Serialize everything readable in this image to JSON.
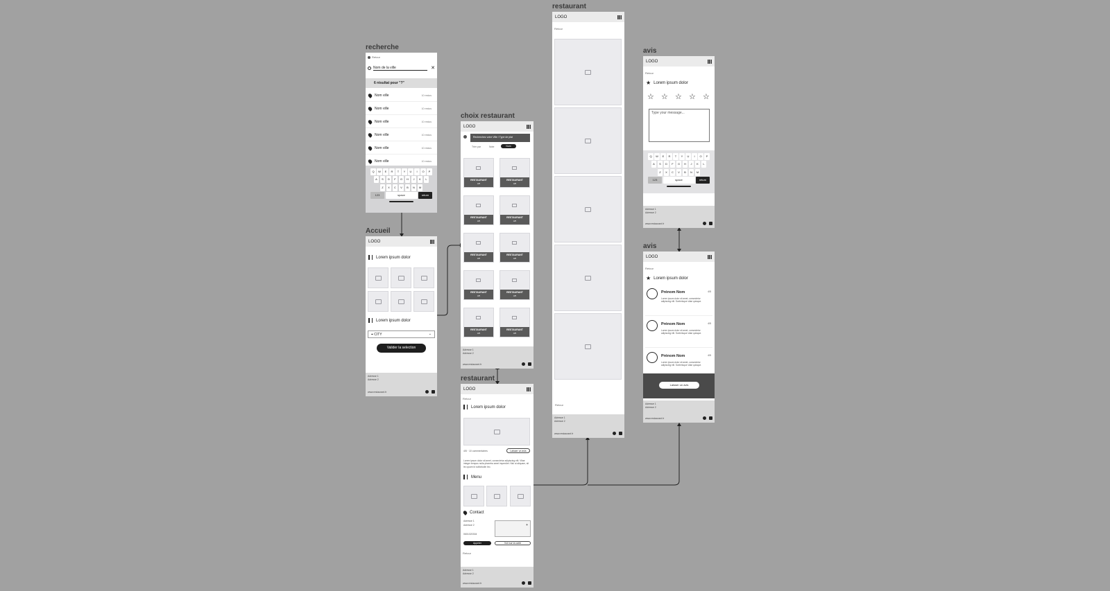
{
  "frames": {
    "recherche": {
      "title": "recherche",
      "back": "Retour",
      "search": "Nom de la ville",
      "results": "6 résultat pour \"?\"",
      "rows": [
        "Nom ville",
        "Nom ville",
        "Nom ville",
        "Nom ville",
        "Nom ville",
        "Nom ville"
      ],
      "row_meta": "10 restos",
      "kb": {
        "r1": [
          "Q",
          "W",
          "E",
          "R",
          "T",
          "Y",
          "U",
          "I",
          "O",
          "P"
        ],
        "r2": [
          "A",
          "S",
          "D",
          "F",
          "G",
          "H",
          "J",
          "K",
          "L"
        ],
        "r3": [
          "Z",
          "X",
          "C",
          "V",
          "B",
          "N",
          "M"
        ],
        "num": "123",
        "space": "space",
        "ret": "return"
      }
    },
    "accueil": {
      "title": "Accueil",
      "logo": "LOGO",
      "sec1": "Lorem ipsum dolor",
      "sec2": "Lorem ipsum dolor",
      "select": "CITY",
      "validate": "Valider la selection"
    },
    "choix": {
      "title": "choix restaurant",
      "logo": "LOGO",
      "search": "Recherchez votre Ville / Type de plat",
      "filt1": "Trier par",
      "filt2": "Note",
      "filt3": "Nom",
      "card_label": "RESTAURANT",
      "card_rating": "4/5"
    },
    "restaurant1": {
      "title": "restaurant",
      "logo": "LOGO",
      "back": "Retour",
      "sec1": "Lorem ipsum dolor",
      "meta": "4/5 · 10 commentaires",
      "btn_small": "Laisser un avis",
      "para": "Lorem ipsum dolor sit amet, consectetur adipiscing elit. Vitae integer tempus nulla pharetra amet imperdiet. Nisi ut aliquam, sit leo quam id sollicitudin leo.",
      "menu": "Menu",
      "contact": "Contact",
      "addr1": "Adresse 1",
      "addr2": "Adresse 2",
      "tel": "0601020304",
      "b1": "Appeler",
      "b2": "Voir sur la carte",
      "back2": "Retour"
    },
    "restaurant2": {
      "title": "restaurant",
      "logo": "LOGO",
      "back": "Retour",
      "back2": "Retour"
    },
    "avis1": {
      "title": "avis",
      "logo": "LOGO",
      "back": "Retour",
      "sec": "Lorem ipsum dolor",
      "placeholder": "Type your message...",
      "num": "123",
      "space": "space",
      "ret": "return"
    },
    "avis2": {
      "title": "avis",
      "logo": "LOGO",
      "back": "Retour",
      "sec": "Lorem ipsum dolor",
      "name1": "Prénom Nom",
      "name2": "Prénom Nom",
      "name3": "Prénom Nom",
      "rating": "4/5",
      "review": "Lorem ipsum dolor sit amet, consectetur adipiscing elit. Scelerisque vitae quisque.",
      "cta": "Laisser un avis"
    },
    "footer": {
      "l1": "Adresse 1",
      "l2": "Adresse 2",
      "l3": "www.restaurant.fr"
    }
  }
}
